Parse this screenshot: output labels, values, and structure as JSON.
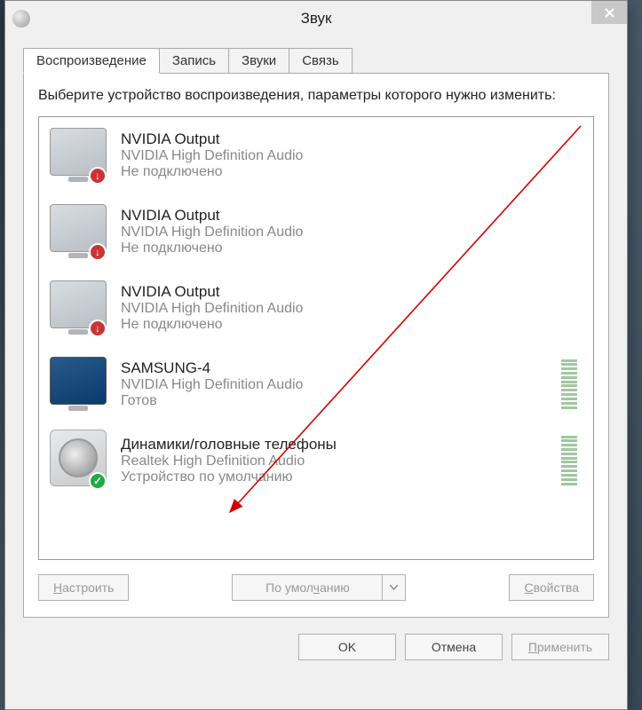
{
  "window": {
    "title": "Звук",
    "instruction": "Выберите устройство воспроизведения, параметры которого нужно изменить:"
  },
  "tabs": [
    {
      "label": "Воспроизведение",
      "active": true
    },
    {
      "label": "Запись",
      "active": false
    },
    {
      "label": "Звуки",
      "active": false
    },
    {
      "label": "Связь",
      "active": false
    }
  ],
  "devices": [
    {
      "name": "NVIDIA Output",
      "desc": "NVIDIA High Definition Audio",
      "status": "Не подключено",
      "icon": "monitor-off",
      "badge": "down",
      "meter": false
    },
    {
      "name": "NVIDIA Output",
      "desc": "NVIDIA High Definition Audio",
      "status": "Не подключено",
      "icon": "monitor-off",
      "badge": "down",
      "meter": false
    },
    {
      "name": "NVIDIA Output",
      "desc": "NVIDIA High Definition Audio",
      "status": "Не подключено",
      "icon": "monitor-off",
      "badge": "down",
      "meter": false
    },
    {
      "name": "SAMSUNG-4",
      "desc": "NVIDIA High Definition Audio",
      "status": "Готов",
      "icon": "monitor-on",
      "badge": "",
      "meter": true
    },
    {
      "name": "Динамики/головные телефоны",
      "desc": "Realtek High Definition Audio",
      "status": "Устройство по умолчанию",
      "icon": "speaker",
      "badge": "ok",
      "meter": true
    }
  ],
  "buttons": {
    "configure": "Настроить",
    "default": "По умолчанию",
    "properties": "Свойства",
    "ok": "OK",
    "cancel": "Отмена",
    "apply": "Применить"
  },
  "access_keys": {
    "configure_u": "Н",
    "default_u": "ч",
    "properties_u": "С",
    "apply_u": "П"
  }
}
